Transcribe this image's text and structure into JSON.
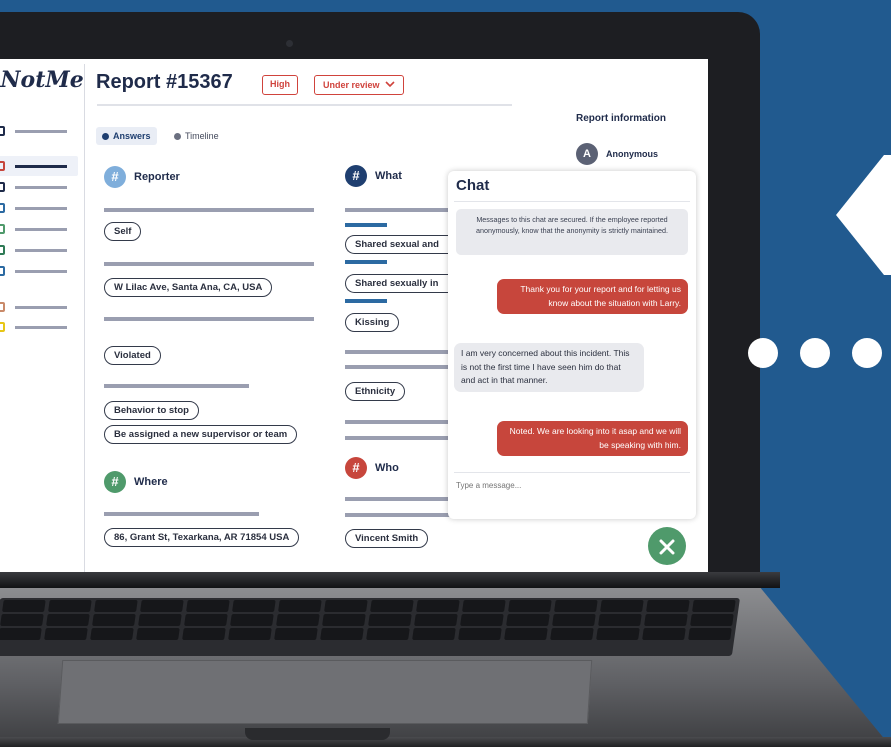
{
  "app": {
    "logo": "#NotMe",
    "title": "Report #15367"
  },
  "priority": "High",
  "status": {
    "label": "Under review",
    "chevron": "⌄"
  },
  "tabs": [
    {
      "label": "Answers",
      "active": true
    },
    {
      "label": "Timeline",
      "active": false
    }
  ],
  "sidebar_icons": [
    {
      "color": "#1f2b4a"
    },
    {
      "color": "#c7463c"
    },
    {
      "color": "#1f2b4a"
    },
    {
      "color": "#2c6aa2"
    },
    {
      "color": "#4f9a6b"
    },
    {
      "color": "#2e7a55"
    },
    {
      "color": "#2c6aa2"
    },
    {
      "color": "#c98a6a"
    },
    {
      "color": "#e7c617"
    }
  ],
  "sections": {
    "reporter": {
      "title": "Reporter",
      "answers": [
        "Self",
        "W Lilac Ave, Santa Ana, CA, USA",
        "Violated",
        "Behavior to stop",
        "Be assigned a new supervisor or team"
      ]
    },
    "where": {
      "title": "Where",
      "answers": [
        "86, Grant St, Texarkana, AR 71854 USA"
      ]
    },
    "what": {
      "title": "What",
      "answers": [
        "Shared sexual and",
        "Shared sexually in",
        "Kissing",
        "Ethnicity"
      ]
    },
    "who": {
      "title": "Who",
      "answers": [
        "Vincent Smith"
      ]
    }
  },
  "report_info": {
    "heading": "Report information",
    "avatar_letter": "A",
    "reporter_name": "Anonymous"
  },
  "chat": {
    "title": "Chat",
    "notice": "Messages to this chat are secured. If the employee reported anonymously, know that the anonymity is strictly maintained.",
    "messages": [
      {
        "from": "agent",
        "text": "Thank you for your report and for letting us know about the situation with Larry."
      },
      {
        "from": "reporter",
        "text": "I am very concerned about this incident. This is not the first time I have seen him do that and act in that manner."
      },
      {
        "from": "agent",
        "text": "Noted. We are looking into it asap and we will be speaking with him."
      }
    ],
    "input_placeholder": "Type a message..."
  },
  "colors": {
    "accent_red": "#d0433c",
    "navy": "#1f2b4a",
    "blue": "#2c6aa2",
    "green": "#4f9a6b",
    "background": "#215a8f"
  },
  "icons": {
    "close": "close-icon",
    "hash": "hash-icon"
  }
}
